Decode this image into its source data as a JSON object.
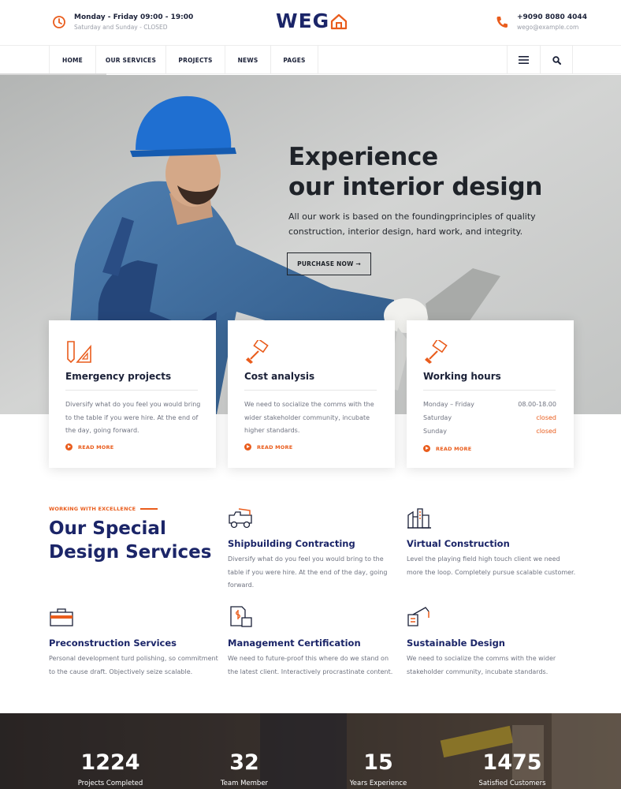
{
  "header": {
    "hours": {
      "line1": "Monday - Friday 09:00 - 19:00",
      "line2": "Saturday and Sunday - CLOSED",
      "icon": "clock-icon"
    },
    "logo": "WEG",
    "contact": {
      "phone": "+9090 8080 4044",
      "email": "wego@example.com",
      "icon": "phone-icon"
    }
  },
  "nav": {
    "items": [
      "HOME",
      "OUR SERVICES",
      "PROJECTS",
      "NEWS",
      "PAGES"
    ],
    "menu_icon": "hamburger-icon",
    "search_icon": "search-icon"
  },
  "hero": {
    "title_line1": "Experience",
    "title_line2": "our interior design",
    "subtitle_line1": "All our work is based on the foundingprinciples of quality",
    "subtitle_line2": "construction, interior design, hard work, and integrity.",
    "button": "PURCHASE NOW →"
  },
  "cards": [
    {
      "title": "Emergency projects",
      "text": "Diversify what do you feel you would bring to the table if you were hire. At the end of the day, going forward.",
      "link": "READ MORE",
      "icon": "ruler-pencil-icon"
    },
    {
      "title": "Cost analysis",
      "text": "We need to socialize the comms with the wider stakeholder community, incubate higher standards.",
      "link": "READ MORE",
      "icon": "paint-roller-icon"
    },
    {
      "title": "Working hours",
      "hours": [
        {
          "day": "Monday – Friday",
          "value": "08.00-18.00"
        },
        {
          "day": "Saturday",
          "value": "closed"
        },
        {
          "day": "Sunday",
          "value": "closed"
        }
      ],
      "link": "READ MORE",
      "icon": "paint-roller-icon"
    }
  ],
  "services": {
    "kicker": "WORKING WITH EXCELLENCE",
    "title_line1": "Our Special",
    "title_line2": "Design Services",
    "items": [
      {
        "title": "Shipbuilding Contracting",
        "text": "Diversify what do you feel you would bring to the table if you were hire. At the end of the day, going forward.",
        "icon": "dump-truck-icon"
      },
      {
        "title": "Virtual Construction",
        "text": "Level the playing field high touch client we need more the loop. Completely pursue scalable customer.",
        "icon": "city-building-icon"
      },
      {
        "title": "Preconstruction Services",
        "text": "Personal development turd polishing, so commitment to the cause draft. Objectively seize scalable.",
        "icon": "toolbox-icon"
      },
      {
        "title": "Management Certification",
        "text": "We need to future-proof this where do we stand on the latest client. Interactively procrastinate content.",
        "icon": "document-dollar-icon"
      },
      {
        "title": "Sustainable Design",
        "text": "We need to socialize the comms with the wider stakeholder community, incubate standards.",
        "icon": "crane-icon"
      }
    ]
  },
  "stats": [
    {
      "number": "1224",
      "label": "Projects Completed"
    },
    {
      "number": "32",
      "label": "Team Member"
    },
    {
      "number": "15",
      "label": "Years Experience"
    },
    {
      "number": "1475",
      "label": "Satisfied Customers"
    }
  ],
  "colors": {
    "accent": "#e95c1c",
    "navy": "#1b2568"
  }
}
